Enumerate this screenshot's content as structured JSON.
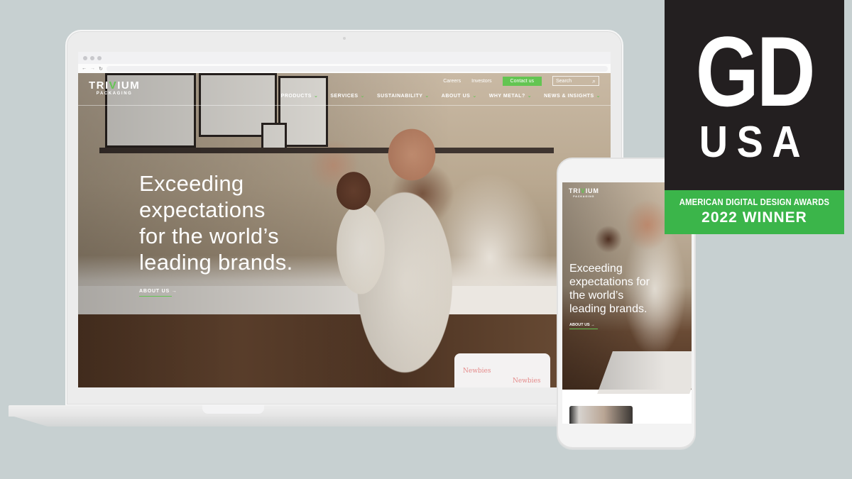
{
  "laptop_site": {
    "browser": {
      "controls": [
        "back",
        "forward",
        "reload"
      ]
    },
    "logo": {
      "main_prefix": "TRI",
      "main_accent": "V",
      "main_suffix": "IUM",
      "sub": "PACKAGING"
    },
    "utility_nav": {
      "careers": "Careers",
      "investors": "Investors",
      "contact": "Contact us",
      "search_placeholder": "Search"
    },
    "main_nav": [
      {
        "label": "PRODUCTS"
      },
      {
        "label": "SERVICES"
      },
      {
        "label": "SUSTAINABILITY"
      },
      {
        "label": "ABOUT US"
      },
      {
        "label": "WHY METAL?"
      },
      {
        "label": "NEWS & INSIGHTS"
      }
    ],
    "hero": {
      "line1": "Exceeding",
      "line2": "expectations",
      "line3": "for the world’s",
      "line4": "leading brands.",
      "cta": "ABOUT US →"
    },
    "product_labels": [
      "Newbies",
      "Newbies"
    ]
  },
  "phone_site": {
    "logo": {
      "main_prefix": "TRI",
      "main_accent": "V",
      "main_suffix": "IUM",
      "sub": "PACKAGING"
    },
    "hero": {
      "line1": "Exceeding",
      "line2": "expectations for",
      "line3": "the world’s",
      "line4": "leading brands.",
      "cta": "ABOUT US →"
    }
  },
  "award": {
    "gd": "GD",
    "usa": "USA",
    "line1": "AMERICAN DIGITAL DESIGN AWARDS",
    "line2": "2022 WINNER"
  },
  "colors": {
    "brand_green": "#63c552",
    "award_green": "#3bb54a",
    "award_black": "#231f20",
    "background": "#c7d0d1"
  }
}
